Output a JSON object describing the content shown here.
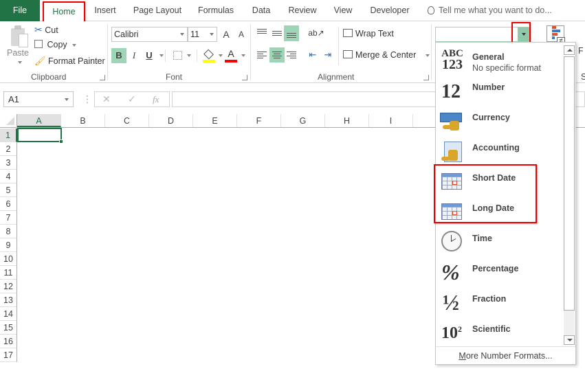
{
  "tabs": {
    "file": "File",
    "home": "Home",
    "insert": "Insert",
    "page_layout": "Page Layout",
    "formulas": "Formulas",
    "data": "Data",
    "review": "Review",
    "view": "View",
    "developer": "Developer",
    "tell_me": "Tell me what you want to do..."
  },
  "clipboard": {
    "paste": "Paste",
    "cut": "Cut",
    "copy": "Copy",
    "format_painter": "Format Painter",
    "label": "Clipboard"
  },
  "font": {
    "name": "Calibri",
    "size": "11",
    "grow": "A",
    "shrink": "A",
    "bold": "B",
    "italic": "I",
    "underline": "U",
    "font_color_letter": "A",
    "fill_color": "#ffff00",
    "font_color": "#ff0000",
    "label": "Font"
  },
  "alignment": {
    "wrap_text": "Wrap Text",
    "merge_center": "Merge & Center",
    "label": "Alignment"
  },
  "number": {
    "format_value": ""
  },
  "formula_bar": {
    "name_box": "A1",
    "cancel": "✕",
    "enter": "✓",
    "fx": "fx",
    "content": ""
  },
  "grid": {
    "columns": [
      "A",
      "B",
      "C",
      "D",
      "E",
      "F",
      "G",
      "H",
      "I"
    ],
    "rows": [
      "1",
      "2",
      "3",
      "4",
      "5",
      "6",
      "7",
      "8",
      "9",
      "10",
      "11",
      "12",
      "13",
      "14",
      "15",
      "16",
      "17"
    ],
    "active_cell": "A1"
  },
  "number_format_menu": {
    "items": [
      {
        "label": "General",
        "sub": "No specific format",
        "icon": "abc-123-icon"
      },
      {
        "label": "Number",
        "icon": "number-12-icon"
      },
      {
        "label": "Currency",
        "icon": "currency-icon"
      },
      {
        "label": "Accounting",
        "icon": "accounting-icon"
      },
      {
        "label": "Short Date",
        "icon": "calendar-icon"
      },
      {
        "label": "Long Date",
        "icon": "calendar-icon"
      },
      {
        "label": "Time",
        "icon": "clock-icon"
      },
      {
        "label": "Percentage",
        "icon": "percent-icon"
      },
      {
        "label": "Fraction",
        "icon": "fraction-icon"
      },
      {
        "label": "Scientific",
        "icon": "scientific-icon"
      }
    ],
    "more": "More Number Formats..."
  },
  "icons": {
    "abc": "ABC",
    "n123": "123",
    "n12": "12",
    "percent": "%",
    "half": "½",
    "ten": "10",
    "sq": "2"
  },
  "right_edge": {
    "frag1": "F",
    "frag2": "S"
  },
  "colors": {
    "accent": "#217346",
    "highlight": "#9fd5b7",
    "annotation": "#ee0000"
  }
}
